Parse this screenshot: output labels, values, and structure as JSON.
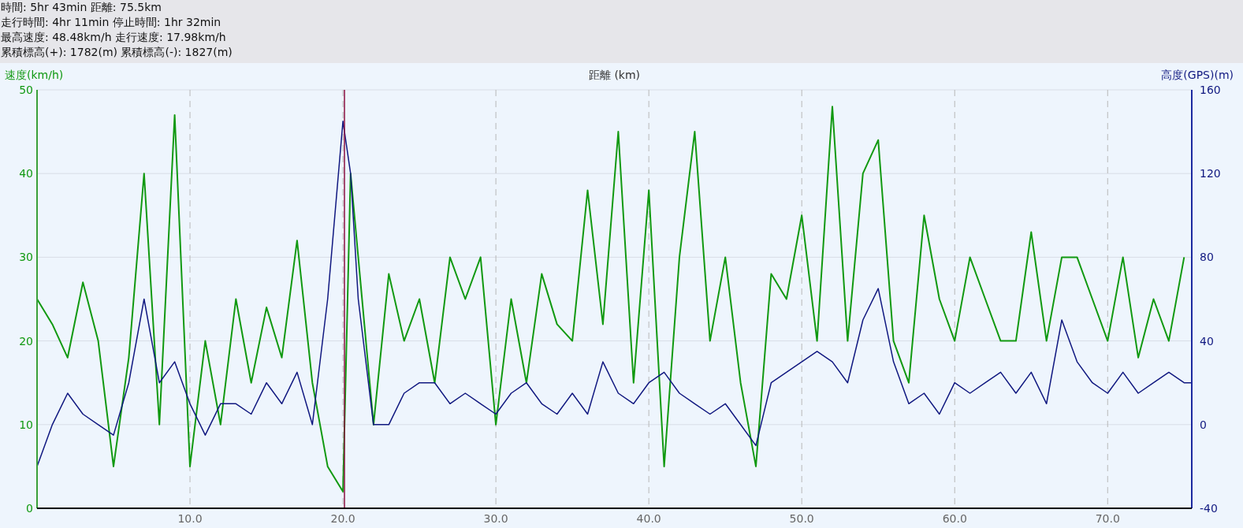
{
  "summary": [
    "時間: 5hr 43min 距離: 75.5km",
    "走行時間: 4hr 11min 停止時間: 1hr 32min",
    "最高速度: 48.48km/h 走行速度: 17.98km/h",
    "累積標高(+): 1782(m) 累積標高(-): 1827(m)"
  ],
  "chart_data": {
    "type": "line",
    "xlabel": "距離 (km)",
    "grid": true,
    "xlim": [
      0,
      75.5
    ],
    "ylim": [
      0,
      50
    ],
    "y2lim": [
      -40,
      160
    ],
    "xticks": [
      {
        "value": 10,
        "label": "10.0"
      },
      {
        "value": 20,
        "label": "20.0"
      },
      {
        "value": 30,
        "label": "30.0"
      },
      {
        "value": 40,
        "label": "40.0"
      },
      {
        "value": 50,
        "label": "50.0"
      },
      {
        "value": 60,
        "label": "60.0"
      },
      {
        "value": 70,
        "label": "70.0"
      }
    ],
    "yticks": [
      0,
      10,
      20,
      30,
      40,
      50
    ],
    "y2ticks": [
      -40,
      0,
      40,
      80,
      120,
      160
    ],
    "x": [
      0,
      1,
      2,
      3,
      4,
      5,
      6,
      7,
      8,
      9,
      10,
      11,
      12,
      13,
      14,
      15,
      16,
      17,
      18,
      19,
      20,
      20.5,
      21,
      22,
      23,
      24,
      25,
      26,
      27,
      28,
      29,
      30,
      31,
      32,
      33,
      34,
      35,
      36,
      37,
      38,
      39,
      40,
      41,
      42,
      43,
      44,
      45,
      46,
      47,
      48,
      49,
      50,
      51,
      52,
      53,
      54,
      55,
      56,
      57,
      58,
      59,
      60,
      61,
      62,
      63,
      64,
      65,
      66,
      67,
      68,
      69,
      70,
      71,
      72,
      73,
      74,
      75,
      75.5
    ],
    "series": [
      {
        "name": "速度(km/h)",
        "color": "#119911",
        "axis": "y",
        "values": [
          25,
          22,
          18,
          27,
          20,
          5,
          18,
          40,
          10,
          47,
          5,
          20,
          10,
          25,
          15,
          24,
          18,
          32,
          15,
          5,
          2,
          40,
          30,
          10,
          28,
          20,
          25,
          15,
          30,
          25,
          30,
          10,
          25,
          15,
          28,
          22,
          20,
          38,
          22,
          45,
          15,
          38,
          5,
          30,
          45,
          20,
          30,
          15,
          5,
          28,
          25,
          35,
          20,
          48,
          20,
          40,
          44,
          20,
          15,
          35,
          25,
          20,
          30,
          25,
          20,
          20,
          33,
          20,
          30,
          30,
          25,
          20,
          30,
          18,
          25,
          20,
          30,
          null
        ]
      },
      {
        "name": "高度(GPS)(m)",
        "color": "#101880",
        "axis": "y2",
        "values": [
          -20,
          0,
          15,
          5,
          0,
          -5,
          20,
          60,
          20,
          30,
          10,
          -5,
          10,
          10,
          5,
          20,
          10,
          25,
          0,
          60,
          145,
          120,
          60,
          0,
          0,
          15,
          20,
          20,
          10,
          15,
          10,
          5,
          15,
          20,
          10,
          5,
          15,
          5,
          30,
          15,
          10,
          20,
          25,
          15,
          10,
          5,
          10,
          0,
          -10,
          20,
          25,
          30,
          35,
          30,
          20,
          50,
          65,
          30,
          10,
          15,
          5,
          20,
          15,
          20,
          25,
          15,
          25,
          10,
          50,
          30,
          20,
          15,
          25,
          15,
          20,
          25,
          20,
          20
        ]
      }
    ],
    "ref_lines": [
      {
        "axis": "x",
        "value": 20.1,
        "color": "#8a1040"
      }
    ]
  }
}
